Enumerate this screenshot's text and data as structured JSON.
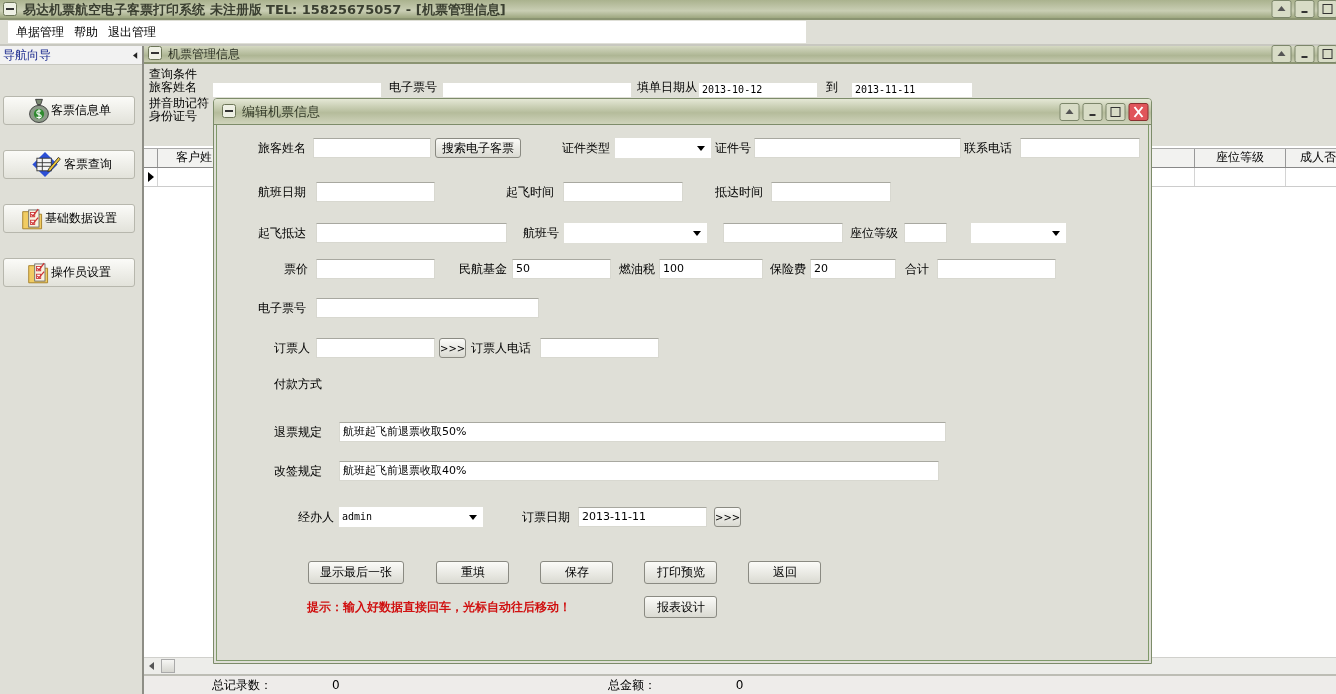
{
  "window": {
    "title": "易达机票航空电子客票打印系统 未注册版  TEL: 15825675057 - [机票管理信息]"
  },
  "menu": [
    "单据管理",
    "帮助",
    "退出管理"
  ],
  "nav": {
    "title": "导航向导",
    "items": [
      "客票信息单",
      "客票查询",
      "基础数据设置",
      "操作员设置"
    ]
  },
  "child": {
    "title": "机票管理信息",
    "query": {
      "title": "查询条件",
      "name_label": "旅客姓名",
      "ticket_label": "电子票号",
      "date_from_label": "填单日期从",
      "date_from": "2013-10-12",
      "date_to_label": "到",
      "date_to": "2013-11-11",
      "pinyin_label": "拼音助记符",
      "id_label": "身份证号"
    },
    "grid": {
      "columns": [
        "客户姓",
        "座位等级",
        "成人否"
      ]
    },
    "status": [
      {
        "label": "总记录数：",
        "value": "0"
      },
      {
        "label": "总金额：",
        "value": "0"
      }
    ]
  },
  "dialog": {
    "title": "编辑机票信息",
    "rows": [
      {
        "items": [
          {
            "kind": "label",
            "text": "旅客姓名"
          },
          {
            "kind": "input"
          },
          {
            "kind": "button",
            "text": "搜索电子客票"
          },
          {
            "kind": "label",
            "text": "证件类型"
          },
          {
            "kind": "select"
          },
          {
            "kind": "label",
            "text": "证件号"
          },
          {
            "kind": "input"
          },
          {
            "kind": "label",
            "text": "联系电话"
          },
          {
            "kind": "input"
          }
        ]
      },
      {
        "items": [
          {
            "kind": "label",
            "text": "航班日期"
          },
          {
            "kind": "input"
          },
          {
            "kind": "label",
            "text": "起飞时间"
          },
          {
            "kind": "input"
          },
          {
            "kind": "label",
            "text": "抵达时间"
          },
          {
            "kind": "input"
          }
        ]
      },
      {
        "items": [
          {
            "kind": "label",
            "text": "起飞抵达"
          },
          {
            "kind": "input"
          },
          {
            "kind": "label",
            "text": "航班号"
          },
          {
            "kind": "select"
          },
          {
            "kind": "input"
          },
          {
            "kind": "label",
            "text": "座位等级"
          },
          {
            "kind": "input"
          },
          {
            "kind": "select"
          }
        ]
      },
      {
        "items": [
          {
            "kind": "label",
            "text": "票价"
          },
          {
            "kind": "input"
          },
          {
            "kind": "label",
            "text": "民航基金"
          },
          {
            "kind": "input",
            "value": "50"
          },
          {
            "kind": "label",
            "text": "燃油税"
          },
          {
            "kind": "input",
            "value": "100"
          },
          {
            "kind": "label",
            "text": "保险费"
          },
          {
            "kind": "input",
            "value": "20"
          },
          {
            "kind": "label",
            "text": "合计"
          },
          {
            "kind": "input"
          }
        ]
      },
      {
        "items": [
          {
            "kind": "label",
            "text": "电子票号"
          },
          {
            "kind": "input"
          }
        ]
      },
      {
        "items": [
          {
            "kind": "label",
            "text": "订票人"
          },
          {
            "kind": "input"
          },
          {
            "kind": "button",
            "text": ">>>"
          },
          {
            "kind": "label",
            "text": "订票人电话"
          },
          {
            "kind": "input"
          }
        ]
      },
      {
        "items": [
          {
            "kind": "label",
            "text": "付款方式"
          }
        ]
      },
      {
        "items": [
          {
            "kind": "label",
            "text": "退票规定"
          },
          {
            "kind": "input",
            "value": "航班起飞前退票收取50%"
          }
        ]
      },
      {
        "items": [
          {
            "kind": "label",
            "text": "改签规定"
          },
          {
            "kind": "input",
            "value": "航班起飞前退票收取40%"
          }
        ]
      },
      {
        "items": [
          {
            "kind": "label",
            "text": "经办人"
          },
          {
            "kind": "select",
            "value": "admin"
          },
          {
            "kind": "label",
            "text": "订票日期"
          },
          {
            "kind": "input",
            "value": "2013-11-11"
          },
          {
            "kind": "button",
            "text": ">>>"
          }
        ]
      },
      {
        "items": [
          {
            "kind": "button",
            "text": "显示最后一张"
          },
          {
            "kind": "button",
            "text": "重填"
          },
          {
            "kind": "button",
            "text": "保存"
          },
          {
            "kind": "button",
            "text": "打印预览"
          },
          {
            "kind": "button",
            "text": "返回"
          }
        ]
      },
      {
        "items": [
          {
            "kind": "hint",
            "text": "提示：输入好数据直接回车，光标自动往后移动！"
          },
          {
            "kind": "button",
            "text": "报表设计"
          }
        ]
      }
    ]
  }
}
